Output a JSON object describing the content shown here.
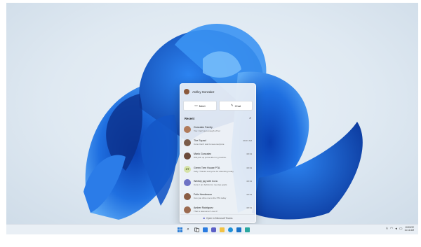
{
  "chat_panel": {
    "user_name": "Ashley Gonzalez",
    "meet_label": "Meet",
    "chat_label": "Chat",
    "recent_label": "Recent",
    "open_teams_label": "Open in Microsoft Teams",
    "conversations": [
      {
        "name": "Gonzalez Family",
        "preview": "You: Can't get enough of her",
        "time": "",
        "avatar_color": "#b07a5a",
        "initials": ""
      },
      {
        "name": "The Squad",
        "preview": "Cora: Can't wait to see everyone",
        "time": "09:07 AM",
        "avatar_color": "#7a5c4a",
        "initials": ""
      },
      {
        "name": "Mario Gonzalez",
        "preview": "Will pick up pizza after my practice.",
        "time": "08:33",
        "avatar_color": "#6b4a3a",
        "initials": ""
      },
      {
        "name": "Green Tree House PTA",
        "preview": "Kelly: Thanks everyone for attending today",
        "time": "08:33",
        "avatar_color": "#d6e3a8",
        "initials": "GT"
      },
      {
        "name": "Weekly jog with Cora",
        "preview": "Cora: I am behind on my step goals",
        "time": "08:33",
        "avatar_color": "#6e72c4",
        "initials": ""
      },
      {
        "name": "Felix Henderson",
        "preview": "Can you drive me to the PTA today",
        "time": "08:33",
        "avatar_color": "#8a5d44",
        "initials": ""
      },
      {
        "name": "Amber Rodriguez",
        "preview": "That is awesome! Love it!",
        "time": "08:33",
        "avatar_color": "#9b6a4f",
        "initials": ""
      }
    ]
  },
  "taskbar": {
    "apps": [
      {
        "name": "start",
        "color": "#2f7fd6"
      },
      {
        "name": "search",
        "color": "#333333"
      },
      {
        "name": "task-view",
        "color": "#333333"
      },
      {
        "name": "widgets",
        "color": "#2a7be0"
      },
      {
        "name": "chat",
        "color": "#5b5fc7"
      },
      {
        "name": "file-explorer",
        "color": "#f2c244"
      },
      {
        "name": "edge",
        "color": "#1e8fd8"
      },
      {
        "name": "store",
        "color": "#1a73c8"
      },
      {
        "name": "mail",
        "color": "#2aa7a0"
      }
    ],
    "date": "10/20/22",
    "time": "11:11 AM"
  }
}
